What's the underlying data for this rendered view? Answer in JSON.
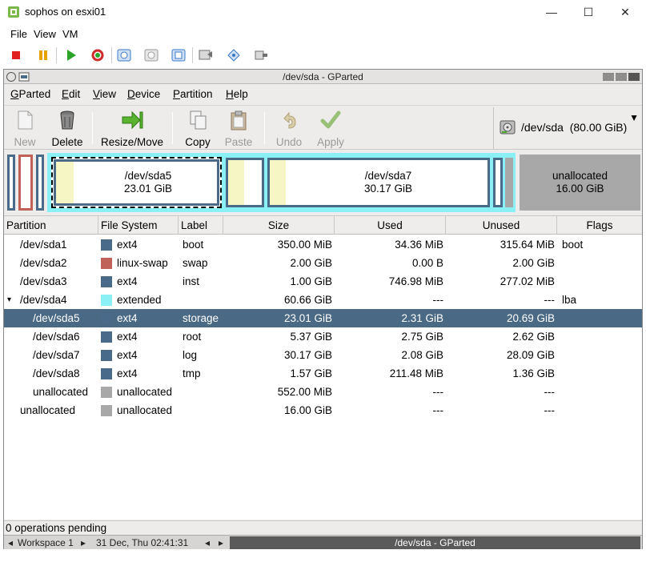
{
  "window": {
    "title": "sophos on esxi01",
    "minimize_glyph": "—",
    "maximize_glyph": "☐",
    "close_glyph": "✕"
  },
  "vm_menu": [
    "File",
    "View",
    "VM"
  ],
  "vm_toolbar": [
    {
      "name": "stop-icon",
      "color": "#e02020"
    },
    {
      "name": "pause-icon",
      "color": "#e8a200"
    },
    {
      "name": "play-icon",
      "color": "#2aa52a"
    },
    {
      "name": "reset-icon",
      "color": "#d02a2a"
    },
    {
      "name": "snapshot-icon",
      "color": "#3a78c8"
    },
    {
      "name": "revert-snapshot-icon",
      "color": "#9a9a9a"
    },
    {
      "name": "manage-snapshots-icon",
      "color": "#3a78c8"
    },
    {
      "name": "console-icon",
      "color": "#707070"
    },
    {
      "name": "connect-device-icon",
      "color": "#3a78c8"
    },
    {
      "name": "settings-icon",
      "color": "#707070"
    }
  ],
  "gparted": {
    "title": "/dev/sda - GParted",
    "menu": [
      {
        "pre": "",
        "u": "G",
        "post": "Parted"
      },
      {
        "pre": "",
        "u": "E",
        "post": "dit"
      },
      {
        "pre": "",
        "u": "V",
        "post": "iew"
      },
      {
        "pre": "",
        "u": "D",
        "post": "evice"
      },
      {
        "pre": "",
        "u": "P",
        "post": "artition"
      },
      {
        "pre": "",
        "u": "H",
        "post": "elp"
      }
    ],
    "toolbar": {
      "new": "New",
      "delete": "Delete",
      "resize_move": "Resize/Move",
      "copy": "Copy",
      "paste": "Paste",
      "undo": "Undo",
      "apply": "Apply"
    },
    "device": {
      "name": "/dev/sda",
      "size": "(80.00 GiB)"
    },
    "map": {
      "sda5": {
        "name": "/dev/sda5",
        "size": "23.01 GiB"
      },
      "sda7": {
        "name": "/dev/sda7",
        "size": "30.17 GiB"
      },
      "unalloc": {
        "name": "unallocated",
        "size": "16.00 GiB"
      }
    },
    "columns": [
      "Partition",
      "File System",
      "Label",
      "Size",
      "Used",
      "Unused",
      "Flags"
    ],
    "rows": [
      {
        "partition": "/dev/sda1",
        "indent": 1,
        "fs": "ext4",
        "color": "#4a6a8a",
        "label": "boot",
        "size": "350.00 MiB",
        "used": "34.36 MiB",
        "unused": "315.64 MiB",
        "flags": "boot",
        "selected": false,
        "expander": ""
      },
      {
        "partition": "/dev/sda2",
        "indent": 1,
        "fs": "linux-swap",
        "color": "#c0615a",
        "label": "swap",
        "size": "2.00 GiB",
        "used": "0.00 B",
        "unused": "2.00 GiB",
        "flags": "",
        "selected": false,
        "expander": ""
      },
      {
        "partition": "/dev/sda3",
        "indent": 1,
        "fs": "ext4",
        "color": "#4a6a8a",
        "label": "inst",
        "size": "1.00 GiB",
        "used": "746.98 MiB",
        "unused": "277.02 MiB",
        "flags": "",
        "selected": false,
        "expander": ""
      },
      {
        "partition": "/dev/sda4",
        "indent": 1,
        "fs": "extended",
        "color": "#8af0f5",
        "label": "",
        "size": "60.66 GiB",
        "used": "---",
        "unused": "---",
        "flags": "lba",
        "selected": false,
        "expander": "▾"
      },
      {
        "partition": "/dev/sda5",
        "indent": 2,
        "fs": "ext4",
        "color": "#4a6a8a",
        "label": "storage",
        "size": "23.01 GiB",
        "used": "2.31 GiB",
        "unused": "20.69 GiB",
        "flags": "",
        "selected": true,
        "expander": ""
      },
      {
        "partition": "/dev/sda6",
        "indent": 2,
        "fs": "ext4",
        "color": "#4a6a8a",
        "label": "root",
        "size": "5.37 GiB",
        "used": "2.75 GiB",
        "unused": "2.62 GiB",
        "flags": "",
        "selected": false,
        "expander": ""
      },
      {
        "partition": "/dev/sda7",
        "indent": 2,
        "fs": "ext4",
        "color": "#4a6a8a",
        "label": "log",
        "size": "30.17 GiB",
        "used": "2.08 GiB",
        "unused": "28.09 GiB",
        "flags": "",
        "selected": false,
        "expander": ""
      },
      {
        "partition": "/dev/sda8",
        "indent": 2,
        "fs": "ext4",
        "color": "#4a6a8a",
        "label": "tmp",
        "size": "1.57 GiB",
        "used": "211.48 MiB",
        "unused": "1.36 GiB",
        "flags": "",
        "selected": false,
        "expander": ""
      },
      {
        "partition": "unallocated",
        "indent": 2,
        "fs": "unallocated",
        "color": "#a8a8a8",
        "label": "",
        "size": "552.00 MiB",
        "used": "---",
        "unused": "---",
        "flags": "",
        "selected": false,
        "expander": ""
      },
      {
        "partition": "unallocated",
        "indent": 1,
        "fs": "unallocated",
        "color": "#a8a8a8",
        "label": "",
        "size": "16.00 GiB",
        "used": "---",
        "unused": "---",
        "flags": "",
        "selected": false,
        "expander": ""
      }
    ],
    "status": "0 operations pending"
  },
  "taskbar": {
    "workspace": "Workspace 1",
    "datetime": "31 Dec, Thu 02:41:31",
    "active_window": "/dev/sda - GParted"
  }
}
